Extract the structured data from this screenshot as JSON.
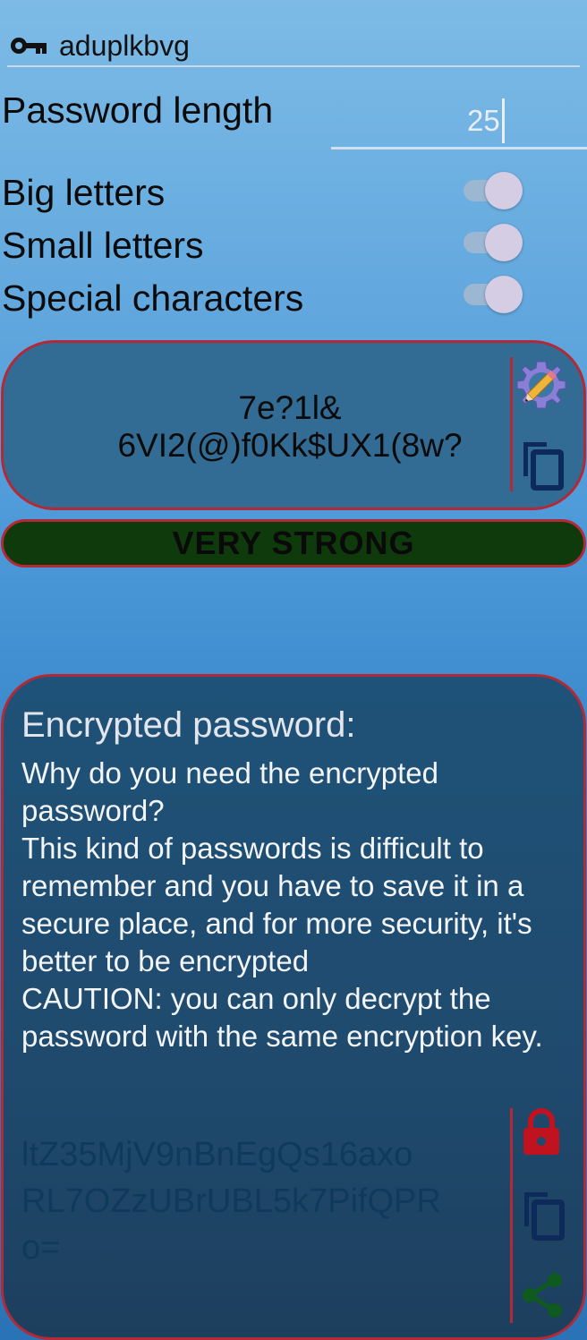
{
  "key_field": {
    "icon": "key-icon",
    "value": "aduplkbvg"
  },
  "password_length": {
    "label": "Password length",
    "value": "25"
  },
  "options": [
    {
      "label": "Big letters",
      "enabled": true
    },
    {
      "label": "Small letters",
      "enabled": true
    },
    {
      "label": "Special characters",
      "enabled": true
    }
  ],
  "generated": {
    "line1": "7e?1l&",
    "line2": "6VI2(@)f0Kk$UX1(8w?",
    "icons": [
      "gear-edit-icon",
      "copy-icon"
    ]
  },
  "strength": {
    "label": "VERY STRONG",
    "color": "#0f3a0b"
  },
  "encrypted": {
    "title": "Encrypted password:",
    "description": "Why do you need the encrypted password?\nThis kind of passwords is difficult to remember and you have to save it in a secure place, and for more security, it's better to be encrypted\nCAUTION: you can only decrypt the password with the same encryption key.",
    "line1": "ltZ35MjV9nBnEgQs16axo",
    "line2": "RL7OZzUBrUBL5k7PifQPR",
    "line3": "o=",
    "icons": [
      "lock-icon",
      "copy-icon",
      "share-icon"
    ]
  },
  "colors": {
    "accent_border": "#b22a38",
    "card": "#326b93",
    "lock": "#c1121f",
    "share": "#0e5a1f",
    "copy": "#0d2a5a"
  }
}
